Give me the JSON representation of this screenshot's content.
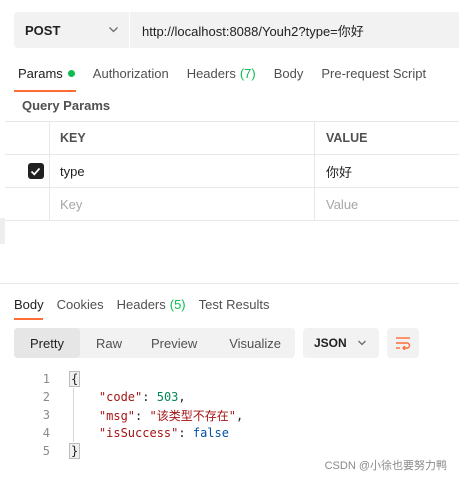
{
  "request": {
    "method": "POST",
    "url": "http://localhost:8088/Youh2?type=你好"
  },
  "request_tabs": {
    "params": "Params",
    "authorization": "Authorization",
    "headers": "Headers",
    "headers_count": "(7)",
    "body": "Body",
    "prerequest": "Pre-request Script"
  },
  "query_params": {
    "title": "Query Params",
    "columns": {
      "key": "KEY",
      "value": "VALUE"
    },
    "rows": [
      {
        "checked": true,
        "key": "type",
        "value": "你好"
      }
    ],
    "placeholder": {
      "key": "Key",
      "value": "Value"
    }
  },
  "response_tabs": {
    "body": "Body",
    "cookies": "Cookies",
    "headers": "Headers",
    "headers_count": "(5)",
    "test_results": "Test Results"
  },
  "view_modes": {
    "pretty": "Pretty",
    "raw": "Raw",
    "preview": "Preview",
    "visualize": "Visualize",
    "selected": "Pretty"
  },
  "format": "JSON",
  "code": {
    "line_numbers": [
      "1",
      "2",
      "3",
      "4",
      "5"
    ],
    "open_brace": "{",
    "close_brace": "}",
    "code_key": "\"code\"",
    "code_val": "503",
    "msg_key": "\"msg\"",
    "msg_val": "\"该类型不存在\"",
    "success_key": "\"isSuccess\"",
    "success_val": "false"
  },
  "watermark": "CSDN @小徐也要努力鸭",
  "colors": {
    "accent": "#ff6c37",
    "status_dot": "#0cbb52",
    "json_key": "#a31515",
    "json_number": "#098658",
    "json_bool": "#0451a5"
  }
}
